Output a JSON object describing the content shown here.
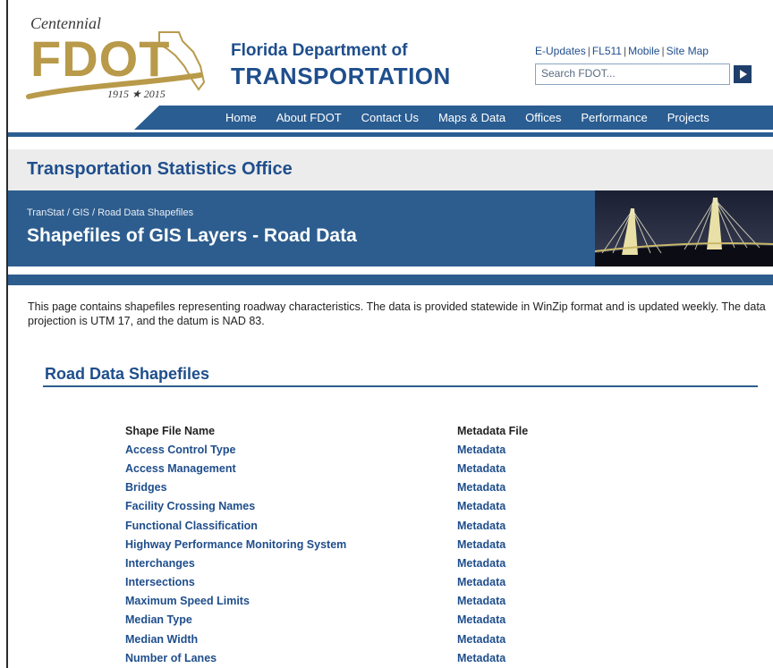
{
  "logo": {
    "script": "Centennial",
    "mark": "FDOT",
    "years": "1915 ★ 2015",
    "icon": "florida-map-swoosh-icon",
    "gold": "#b89a4a"
  },
  "header": {
    "dept_name": "Florida Department of",
    "dept_sub": "TRANSPORTATION",
    "util_links": [
      "E-Updates",
      "FL511",
      "Mobile",
      "Site Map"
    ],
    "search_placeholder": "Search FDOT...",
    "search_icon": "play-arrow-icon"
  },
  "nav": {
    "items": [
      "Home",
      "About FDOT",
      "Contact Us",
      "Maps & Data",
      "Offices",
      "Performance",
      "Projects"
    ]
  },
  "office": {
    "title": "Transportation Statistics Office"
  },
  "banner": {
    "breadcrumb": "TranStat / GIS / Road Data Shapefiles",
    "title": "Shapefiles of GIS Layers - Road Data",
    "photo_icon": "bridge-photo-icon"
  },
  "intro": {
    "text": "This page contains shapefiles representing roadway characteristics. The data is provided statewide in WinZip format and is updated weekly. The data projection is UTM 17, and the datum is NAD 83."
  },
  "section": {
    "title": "Road Data Shapefiles"
  },
  "table": {
    "headers": [
      "Shape File Name",
      "Metadata File"
    ],
    "rows": [
      [
        "Access Control Type",
        "Metadata"
      ],
      [
        "Access Management",
        "Metadata"
      ],
      [
        "Bridges",
        "Metadata"
      ],
      [
        "Facility Crossing Names",
        "Metadata"
      ],
      [
        "Functional Classification",
        "Metadata"
      ],
      [
        "Highway Performance Monitoring System",
        "Metadata"
      ],
      [
        "Interchanges",
        "Metadata"
      ],
      [
        "Intersections",
        "Metadata"
      ],
      [
        "Maximum Speed Limits",
        "Metadata"
      ],
      [
        "Median Type",
        "Metadata"
      ],
      [
        "Median Width",
        "Metadata"
      ],
      [
        "Number of Lanes",
        "Metadata"
      ]
    ]
  },
  "colors": {
    "brand_blue": "#1f4e8c",
    "nav_blue": "#2a5d91",
    "banner_blue": "#2d5d8e"
  }
}
